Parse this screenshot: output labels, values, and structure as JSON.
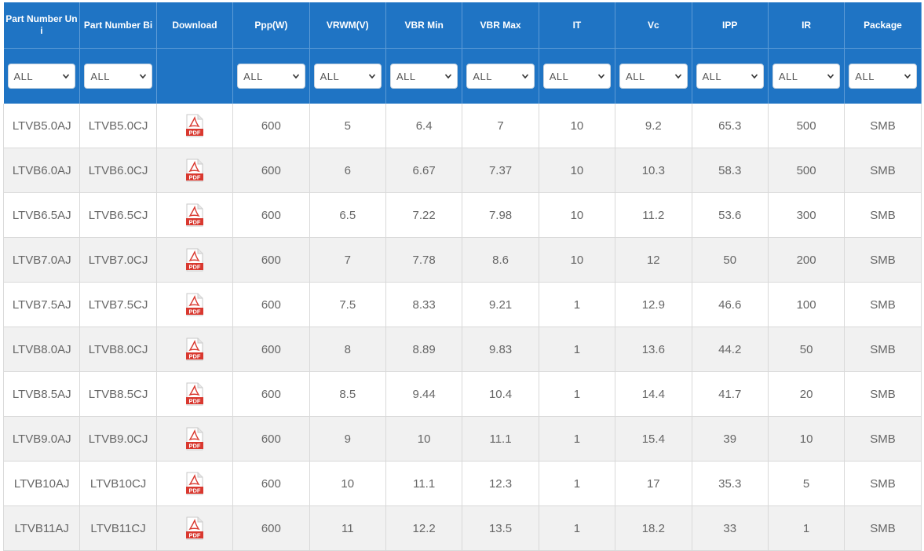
{
  "table": {
    "headers": [
      "Part Number Uni",
      "Part Number Bi",
      "Download",
      "Ppp(W)",
      "VRWM(V)",
      "VBR Min",
      "VBR Max",
      "IT",
      "Vc",
      "IPP",
      "IR",
      "Package"
    ],
    "filter_default": "ALL",
    "rows": [
      [
        "LTVB5.0AJ",
        "LTVB5.0CJ",
        "PDF",
        "600",
        "5",
        "6.4",
        "7",
        "10",
        "9.2",
        "65.3",
        "500",
        "SMB"
      ],
      [
        "LTVB6.0AJ",
        "LTVB6.0CJ",
        "PDF",
        "600",
        "6",
        "6.67",
        "7.37",
        "10",
        "10.3",
        "58.3",
        "500",
        "SMB"
      ],
      [
        "LTVB6.5AJ",
        "LTVB6.5CJ",
        "PDF",
        "600",
        "6.5",
        "7.22",
        "7.98",
        "10",
        "11.2",
        "53.6",
        "300",
        "SMB"
      ],
      [
        "LTVB7.0AJ",
        "LTVB7.0CJ",
        "PDF",
        "600",
        "7",
        "7.78",
        "8.6",
        "10",
        "12",
        "50",
        "200",
        "SMB"
      ],
      [
        "LTVB7.5AJ",
        "LTVB7.5CJ",
        "PDF",
        "600",
        "7.5",
        "8.33",
        "9.21",
        "1",
        "12.9",
        "46.6",
        "100",
        "SMB"
      ],
      [
        "LTVB8.0AJ",
        "LTVB8.0CJ",
        "PDF",
        "600",
        "8",
        "8.89",
        "9.83",
        "1",
        "13.6",
        "44.2",
        "50",
        "SMB"
      ],
      [
        "LTVB8.5AJ",
        "LTVB8.5CJ",
        "PDF",
        "600",
        "8.5",
        "9.44",
        "10.4",
        "1",
        "14.4",
        "41.7",
        "20",
        "SMB"
      ],
      [
        "LTVB9.0AJ",
        "LTVB9.0CJ",
        "PDF",
        "600",
        "9",
        "10",
        "11.1",
        "1",
        "15.4",
        "39",
        "10",
        "SMB"
      ],
      [
        "LTVB10AJ",
        "LTVB10CJ",
        "PDF",
        "600",
        "10",
        "11.1",
        "12.3",
        "1",
        "17",
        "35.3",
        "5",
        "SMB"
      ],
      [
        "LTVB11AJ",
        "LTVB11CJ",
        "PDF",
        "600",
        "11",
        "12.2",
        "13.5",
        "1",
        "18.2",
        "33",
        "1",
        "SMB"
      ]
    ]
  },
  "icons": {
    "download": "pdf-file-icon",
    "dropdown": "chevron-down-icon"
  },
  "colors": {
    "header_bg": "#1f74c4",
    "pdf_red": "#d9382f",
    "row_alt": "#f1f1f1"
  }
}
